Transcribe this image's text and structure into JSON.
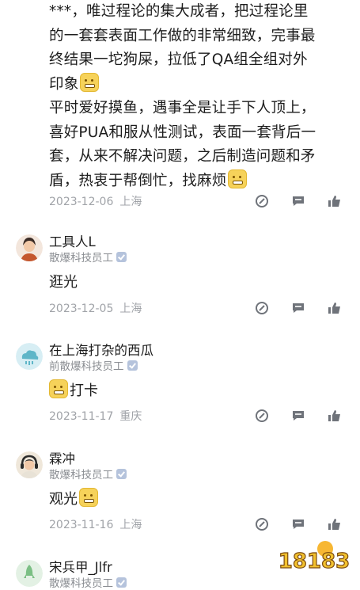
{
  "post": {
    "lines": [
      "***，唯过程论的集大成者，把过程论里",
      "的一套套表面工作做的非常细致，完事最",
      "终结果一坨狗屎，拉低了QA组全组对外",
      "印象"
    ],
    "lines2": [
      "平时爱好摸鱼，遇事全是让手下人顶上，",
      "喜好PUA和服从性测试，表面一套背后一",
      "套，从来不解决问题，之后制造问题和矛",
      "盾，热衷于帮倒忙，找麻烦"
    ],
    "date": "2023-12-06",
    "location": "上海"
  },
  "comments": [
    {
      "username": "工具人L",
      "company": "散爆科技员工",
      "text": "逛光",
      "date": "2023-12-05",
      "location": "上海",
      "avatar": "avatar-man-icon"
    },
    {
      "username": "在上海打杂的西瓜",
      "company": "前散爆科技员工",
      "text": "打卡",
      "date": "2023-11-17",
      "location": "重庆",
      "avatar": "cloud-avatar-icon"
    },
    {
      "username": "霖冲",
      "company": "散爆科技员工",
      "text": "观光",
      "date": "2023-11-16",
      "location": "上海",
      "avatar": "avatar-headphones-icon"
    },
    {
      "username": "宋兵甲_Jlfr",
      "company": "散爆科技员工",
      "avatar": "rocket-avatar-icon"
    }
  ],
  "icons": [
    "reply-icon",
    "comment-icon",
    "like-icon",
    "verified-badge-icon",
    "smile-emoji-icon"
  ],
  "watermark": {
    "text": "18183"
  },
  "colors": {
    "meta": "#a0a3a8",
    "icon": "#6f737a",
    "badge": "#b5c3dc"
  }
}
